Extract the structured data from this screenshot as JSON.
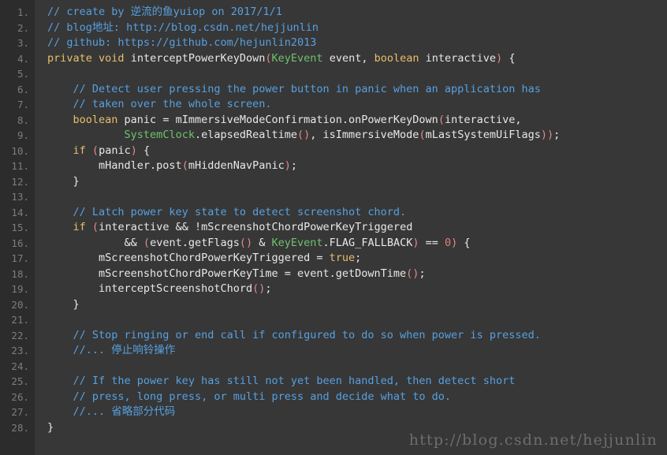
{
  "editor": {
    "background": "#373737",
    "gutter_background": "#2c2c2c",
    "line_number_color": "#7d7d7d",
    "default_text_color": "#e8e8e8",
    "total_lines": 28,
    "language": "java"
  },
  "colors": {
    "comment": "#57a0e0",
    "keyword": "#e8bf6a",
    "type": "#6fc26f",
    "parameter": "#d9a24a",
    "number": "#e47d7d",
    "paren": "#e08b8b",
    "plain": "#e8e8e8"
  },
  "gutter": {
    "numbers": [
      "1.",
      "2.",
      "3.",
      "4.",
      "5.",
      "6.",
      "7.",
      "8.",
      "9.",
      "10.",
      "11.",
      "12.",
      "13.",
      "14.",
      "15.",
      "16.",
      "17.",
      "18.",
      "19.",
      "20.",
      "21.",
      "22.",
      "23.",
      "24.",
      "25.",
      "26.",
      "27.",
      "28."
    ]
  },
  "watermark": {
    "text": "http://blog.csdn.net/hejjunlin",
    "color": "#6d6d6d"
  },
  "code": {
    "lines": [
      {
        "number": 1,
        "text": "// create by 逆流的鱼yuiop on 2017/1/1",
        "tokens": [
          {
            "t": "// create by 逆流的鱼yuiop on 2017/1/1",
            "c": "comment"
          }
        ]
      },
      {
        "number": 2,
        "text": "// blog地址: http://blog.csdn.net/hejjunlin",
        "tokens": [
          {
            "t": "// blog地址: http://blog.csdn.net/hejjunlin",
            "c": "comment"
          }
        ]
      },
      {
        "number": 3,
        "text": "// github: https://github.com/hejunlin2013",
        "tokens": [
          {
            "t": "// github: https://github.com/hejunlin2013",
            "c": "comment"
          }
        ]
      },
      {
        "number": 4,
        "text": "private void interceptPowerKeyDown(KeyEvent event, boolean interactive) {",
        "tokens": [
          {
            "t": "private",
            "c": "keyword"
          },
          {
            "t": " ",
            "c": "plain"
          },
          {
            "t": "void",
            "c": "keyword"
          },
          {
            "t": " interceptPowerKeyDown",
            "c": "plain"
          },
          {
            "t": "(",
            "c": "paren"
          },
          {
            "t": "KeyEvent",
            "c": "type"
          },
          {
            "t": " ",
            "c": "plain"
          },
          {
            "t": "event",
            "c": "parameter"
          },
          {
            "t": ", ",
            "c": "plain"
          },
          {
            "t": "boolean",
            "c": "keyword"
          },
          {
            "t": " ",
            "c": "plain"
          },
          {
            "t": "interactive",
            "c": "parameter"
          },
          {
            "t": ")",
            "c": "paren"
          },
          {
            "t": " {",
            "c": "plain"
          }
        ]
      },
      {
        "number": 5,
        "text": "",
        "tokens": []
      },
      {
        "number": 6,
        "text": "    // Detect user pressing the power button in panic when an application has",
        "tokens": [
          {
            "t": "    ",
            "c": "plain"
          },
          {
            "t": "// Detect user pressing the power button in panic when an application has",
            "c": "comment"
          }
        ]
      },
      {
        "number": 7,
        "text": "    // taken over the whole screen.",
        "tokens": [
          {
            "t": "    ",
            "c": "plain"
          },
          {
            "t": "// taken over the whole screen.",
            "c": "comment"
          }
        ]
      },
      {
        "number": 8,
        "text": "    boolean panic = mImmersiveModeConfirmation.onPowerKeyDown(interactive,",
        "tokens": [
          {
            "t": "    ",
            "c": "plain"
          },
          {
            "t": "boolean",
            "c": "keyword"
          },
          {
            "t": " panic = mImmersiveModeConfirmation.onPowerKeyDown",
            "c": "plain"
          },
          {
            "t": "(",
            "c": "paren"
          },
          {
            "t": "interactive",
            "c": "plain"
          },
          {
            "t": ",",
            "c": "plain"
          }
        ]
      },
      {
        "number": 9,
        "text": "            SystemClock.elapsedRealtime(), isImmersiveMode(mLastSystemUiFlags));",
        "tokens": [
          {
            "t": "            ",
            "c": "plain"
          },
          {
            "t": "SystemClock",
            "c": "type"
          },
          {
            "t": ".elapsedRealtime",
            "c": "plain"
          },
          {
            "t": "()",
            "c": "paren"
          },
          {
            "t": ", isImmersiveMode",
            "c": "plain"
          },
          {
            "t": "(",
            "c": "paren"
          },
          {
            "t": "mLastSystemUiFlags",
            "c": "plain"
          },
          {
            "t": "))",
            "c": "paren"
          },
          {
            "t": ";",
            "c": "plain"
          }
        ]
      },
      {
        "number": 10,
        "text": "    if (panic) {",
        "tokens": [
          {
            "t": "    ",
            "c": "plain"
          },
          {
            "t": "if",
            "c": "keyword"
          },
          {
            "t": " ",
            "c": "plain"
          },
          {
            "t": "(",
            "c": "paren"
          },
          {
            "t": "panic",
            "c": "plain"
          },
          {
            "t": ")",
            "c": "paren"
          },
          {
            "t": " {",
            "c": "plain"
          }
        ]
      },
      {
        "number": 11,
        "text": "        mHandler.post(mHiddenNavPanic);",
        "tokens": [
          {
            "t": "        mHandler.post",
            "c": "plain"
          },
          {
            "t": "(",
            "c": "paren"
          },
          {
            "t": "mHiddenNavPanic",
            "c": "plain"
          },
          {
            "t": ")",
            "c": "paren"
          },
          {
            "t": ";",
            "c": "plain"
          }
        ]
      },
      {
        "number": 12,
        "text": "    }",
        "tokens": [
          {
            "t": "    }",
            "c": "plain"
          }
        ]
      },
      {
        "number": 13,
        "text": "",
        "tokens": []
      },
      {
        "number": 14,
        "text": "    // Latch power key state to detect screenshot chord.",
        "tokens": [
          {
            "t": "    ",
            "c": "plain"
          },
          {
            "t": "// Latch power key state to detect screenshot chord.",
            "c": "comment"
          }
        ]
      },
      {
        "number": 15,
        "text": "    if (interactive && !mScreenshotChordPowerKeyTriggered",
        "tokens": [
          {
            "t": "    ",
            "c": "plain"
          },
          {
            "t": "if",
            "c": "keyword"
          },
          {
            "t": " ",
            "c": "plain"
          },
          {
            "t": "(",
            "c": "paren"
          },
          {
            "t": "interactive && !mScreenshotChordPowerKeyTriggered",
            "c": "plain"
          }
        ]
      },
      {
        "number": 16,
        "text": "            && (event.getFlags() & KeyEvent.FLAG_FALLBACK) == 0) {",
        "tokens": [
          {
            "t": "            && ",
            "c": "plain"
          },
          {
            "t": "(",
            "c": "paren"
          },
          {
            "t": "event",
            "c": "parameter"
          },
          {
            "t": ".getFlags",
            "c": "plain"
          },
          {
            "t": "()",
            "c": "paren"
          },
          {
            "t": " & ",
            "c": "plain"
          },
          {
            "t": "KeyEvent",
            "c": "type"
          },
          {
            "t": ".FLAG_FALLBACK",
            "c": "plain"
          },
          {
            "t": ")",
            "c": "paren"
          },
          {
            "t": " == ",
            "c": "plain"
          },
          {
            "t": "0",
            "c": "number"
          },
          {
            "t": ")",
            "c": "paren"
          },
          {
            "t": " {",
            "c": "plain"
          }
        ]
      },
      {
        "number": 17,
        "text": "        mScreenshotChordPowerKeyTriggered = true;",
        "tokens": [
          {
            "t": "        mScreenshotChordPowerKeyTriggered = ",
            "c": "plain"
          },
          {
            "t": "true",
            "c": "keyword"
          },
          {
            "t": ";",
            "c": "plain"
          }
        ]
      },
      {
        "number": 18,
        "text": "        mScreenshotChordPowerKeyTime = event.getDownTime();",
        "tokens": [
          {
            "t": "        mScreenshotChordPowerKeyTime = ",
            "c": "plain"
          },
          {
            "t": "event",
            "c": "parameter"
          },
          {
            "t": ".getDownTime",
            "c": "plain"
          },
          {
            "t": "()",
            "c": "paren"
          },
          {
            "t": ";",
            "c": "plain"
          }
        ]
      },
      {
        "number": 19,
        "text": "        interceptScreenshotChord();",
        "tokens": [
          {
            "t": "        interceptScreenshotChord",
            "c": "plain"
          },
          {
            "t": "()",
            "c": "paren"
          },
          {
            "t": ";",
            "c": "plain"
          }
        ]
      },
      {
        "number": 20,
        "text": "    }",
        "tokens": [
          {
            "t": "    }",
            "c": "plain"
          }
        ]
      },
      {
        "number": 21,
        "text": "",
        "tokens": []
      },
      {
        "number": 22,
        "text": "    // Stop ringing or end call if configured to do so when power is pressed.",
        "tokens": [
          {
            "t": "    ",
            "c": "plain"
          },
          {
            "t": "// Stop ringing or end call if configured to do so when power is pressed.",
            "c": "comment"
          }
        ]
      },
      {
        "number": 23,
        "text": "    //... 停止响铃操作",
        "tokens": [
          {
            "t": "    ",
            "c": "plain"
          },
          {
            "t": "//... 停止响铃操作",
            "c": "comment"
          }
        ]
      },
      {
        "number": 24,
        "text": "",
        "tokens": []
      },
      {
        "number": 25,
        "text": "    // If the power key has still not yet been handled, then detect short",
        "tokens": [
          {
            "t": "    ",
            "c": "plain"
          },
          {
            "t": "// If the power key has still not yet been handled, then detect short",
            "c": "comment"
          }
        ]
      },
      {
        "number": 26,
        "text": "    // press, long press, or multi press and decide what to do.",
        "tokens": [
          {
            "t": "    ",
            "c": "plain"
          },
          {
            "t": "// press, long press, or multi press and decide what to do.",
            "c": "comment"
          }
        ]
      },
      {
        "number": 27,
        "text": "    //... 省略部分代码",
        "tokens": [
          {
            "t": "    ",
            "c": "plain"
          },
          {
            "t": "//... 省略部分代码",
            "c": "comment"
          }
        ]
      },
      {
        "number": 28,
        "text": "}",
        "tokens": [
          {
            "t": "}",
            "c": "plain"
          }
        ]
      }
    ]
  }
}
